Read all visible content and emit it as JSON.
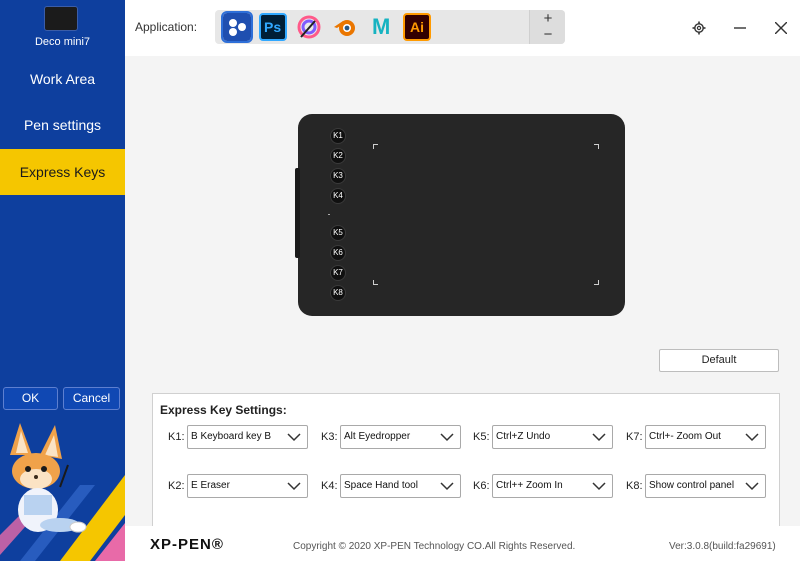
{
  "sidebar": {
    "device_name": "Deco mini7",
    "items": [
      {
        "label": "Work Area"
      },
      {
        "label": "Pen settings"
      },
      {
        "label": "Express Keys"
      }
    ],
    "ok_label": "OK",
    "cancel_label": "Cancel"
  },
  "topbar": {
    "application_label": "Application:",
    "apps": [
      {
        "name": "all-apps-icon",
        "text": ""
      },
      {
        "name": "photoshop-icon",
        "text": "Ps"
      },
      {
        "name": "sketch-app-icon",
        "text": ""
      },
      {
        "name": "blender-icon",
        "text": ""
      },
      {
        "name": "maya-icon",
        "text": "M"
      },
      {
        "name": "illustrator-icon",
        "text": "Ai"
      }
    ],
    "add_label": "+",
    "remove_label": "−"
  },
  "tablet": {
    "keys": [
      "K1",
      "K2",
      "K3",
      "K4",
      "K5",
      "K6",
      "K7",
      "K8"
    ]
  },
  "main": {
    "default_button": "Default",
    "settings_title": "Express Key Settings:",
    "key_settings": [
      {
        "label": "K1:",
        "value": "B Keyboard key B"
      },
      {
        "label": "K2:",
        "value": "E Eraser"
      },
      {
        "label": "K3:",
        "value": "Alt Eyedropper"
      },
      {
        "label": "K4:",
        "value": "Space Hand tool"
      },
      {
        "label": "K5:",
        "value": "Ctrl+Z Undo"
      },
      {
        "label": "K6:",
        "value": "Ctrl++ Zoom In"
      },
      {
        "label": "K7:",
        "value": "Ctrl+- Zoom Out"
      },
      {
        "label": "K8:",
        "value": "Show control panel"
      }
    ]
  },
  "footer": {
    "brand": "XP-PEN®",
    "copyright": "Copyright © 2020 XP-PEN Technology CO.All Rights Reserved.",
    "version": "Ver:3.0.8(build:fa29691)"
  },
  "colors": {
    "sidebar": "#0e3f9e",
    "active_item": "#f5c600",
    "main_bg": "#f4f4f4"
  }
}
